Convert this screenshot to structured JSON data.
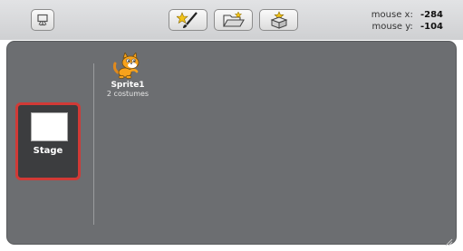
{
  "toolbar": {
    "presentation_icon": "presentation-mode-icon",
    "paint_icon": "paint-new-sprite-icon",
    "folder_icon": "choose-sprite-from-file-icon",
    "surprise_icon": "get-surprise-sprite-icon"
  },
  "mouse": {
    "x_label": "mouse x:",
    "x_value": "-284",
    "y_label": "mouse y:",
    "y_value": "-104"
  },
  "stage": {
    "label": "Stage"
  },
  "sprites": [
    {
      "name": "Sprite1",
      "costumes": "2 costumes"
    }
  ],
  "colors": {
    "panel": "#6c6e71",
    "stage_selected_border": "#d13a36",
    "stage_tile": "#3c3d3f"
  }
}
